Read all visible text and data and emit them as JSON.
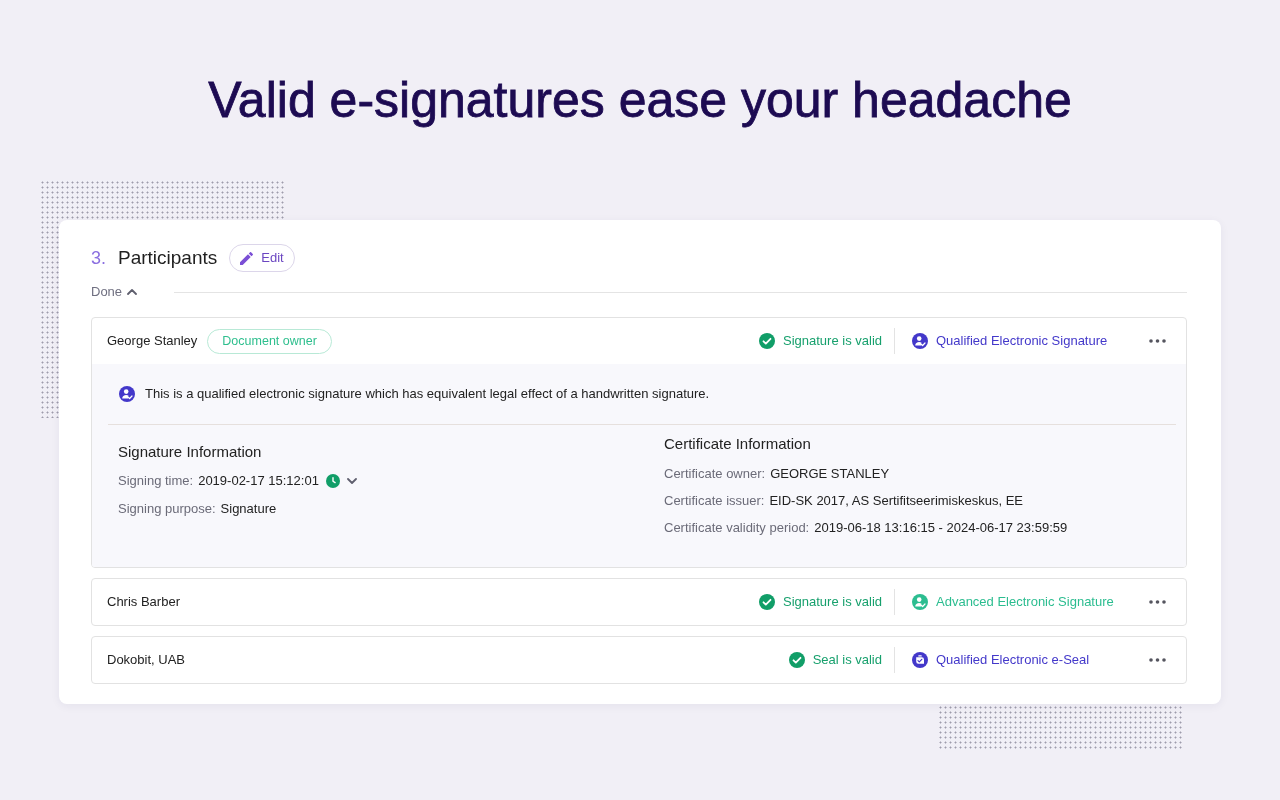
{
  "heading": "Valid e-signatures ease your headache",
  "section": {
    "number": "3.",
    "title": "Participants",
    "edit_button": "Edit",
    "toggle": {
      "label": "Done",
      "expanded": true
    }
  },
  "participants": [
    {
      "name": "George Stanley",
      "badge": "Document owner",
      "status": {
        "label": "Signature is valid",
        "valid": true
      },
      "signature_type": {
        "label": "Qualified Electronic Signature",
        "kind": "signature",
        "color": "#4338ca"
      },
      "expanded": true,
      "details": {
        "note": "This is a qualified electronic signature which has equivalent legal effect of a handwritten signature.",
        "signature_info": {
          "title": "Signature Information",
          "fields": [
            {
              "label": "Signing time:",
              "value": "2019-02-17 15:12:01",
              "timestamped": true
            },
            {
              "label": "Signing purpose:",
              "value": "Signature",
              "timestamped": false
            }
          ]
        },
        "certificate_info": {
          "title": "Certificate Information",
          "fields": [
            {
              "label": "Certificate owner:",
              "value": "GEORGE STANLEY"
            },
            {
              "label": "Certificate issuer:",
              "value": "EID-SK 2017, AS Sertifitseerimiskeskus, EE"
            },
            {
              "label": "Certificate validity period:",
              "value": "2019-06-18 13:16:15 - 2024-06-17 23:59:59"
            }
          ]
        }
      }
    },
    {
      "name": "Chris Barber",
      "status": {
        "label": "Signature is valid",
        "valid": true
      },
      "signature_type": {
        "label": "Advanced Electronic Signature",
        "kind": "signature",
        "color": "#2cbd90"
      },
      "expanded": false
    },
    {
      "name": "Dokobit, UAB",
      "status": {
        "label": "Seal is valid",
        "valid": true
      },
      "signature_type": {
        "label": "Qualified Electronic e-Seal",
        "kind": "seal",
        "color": "#4338ca"
      },
      "expanded": false
    }
  ]
}
